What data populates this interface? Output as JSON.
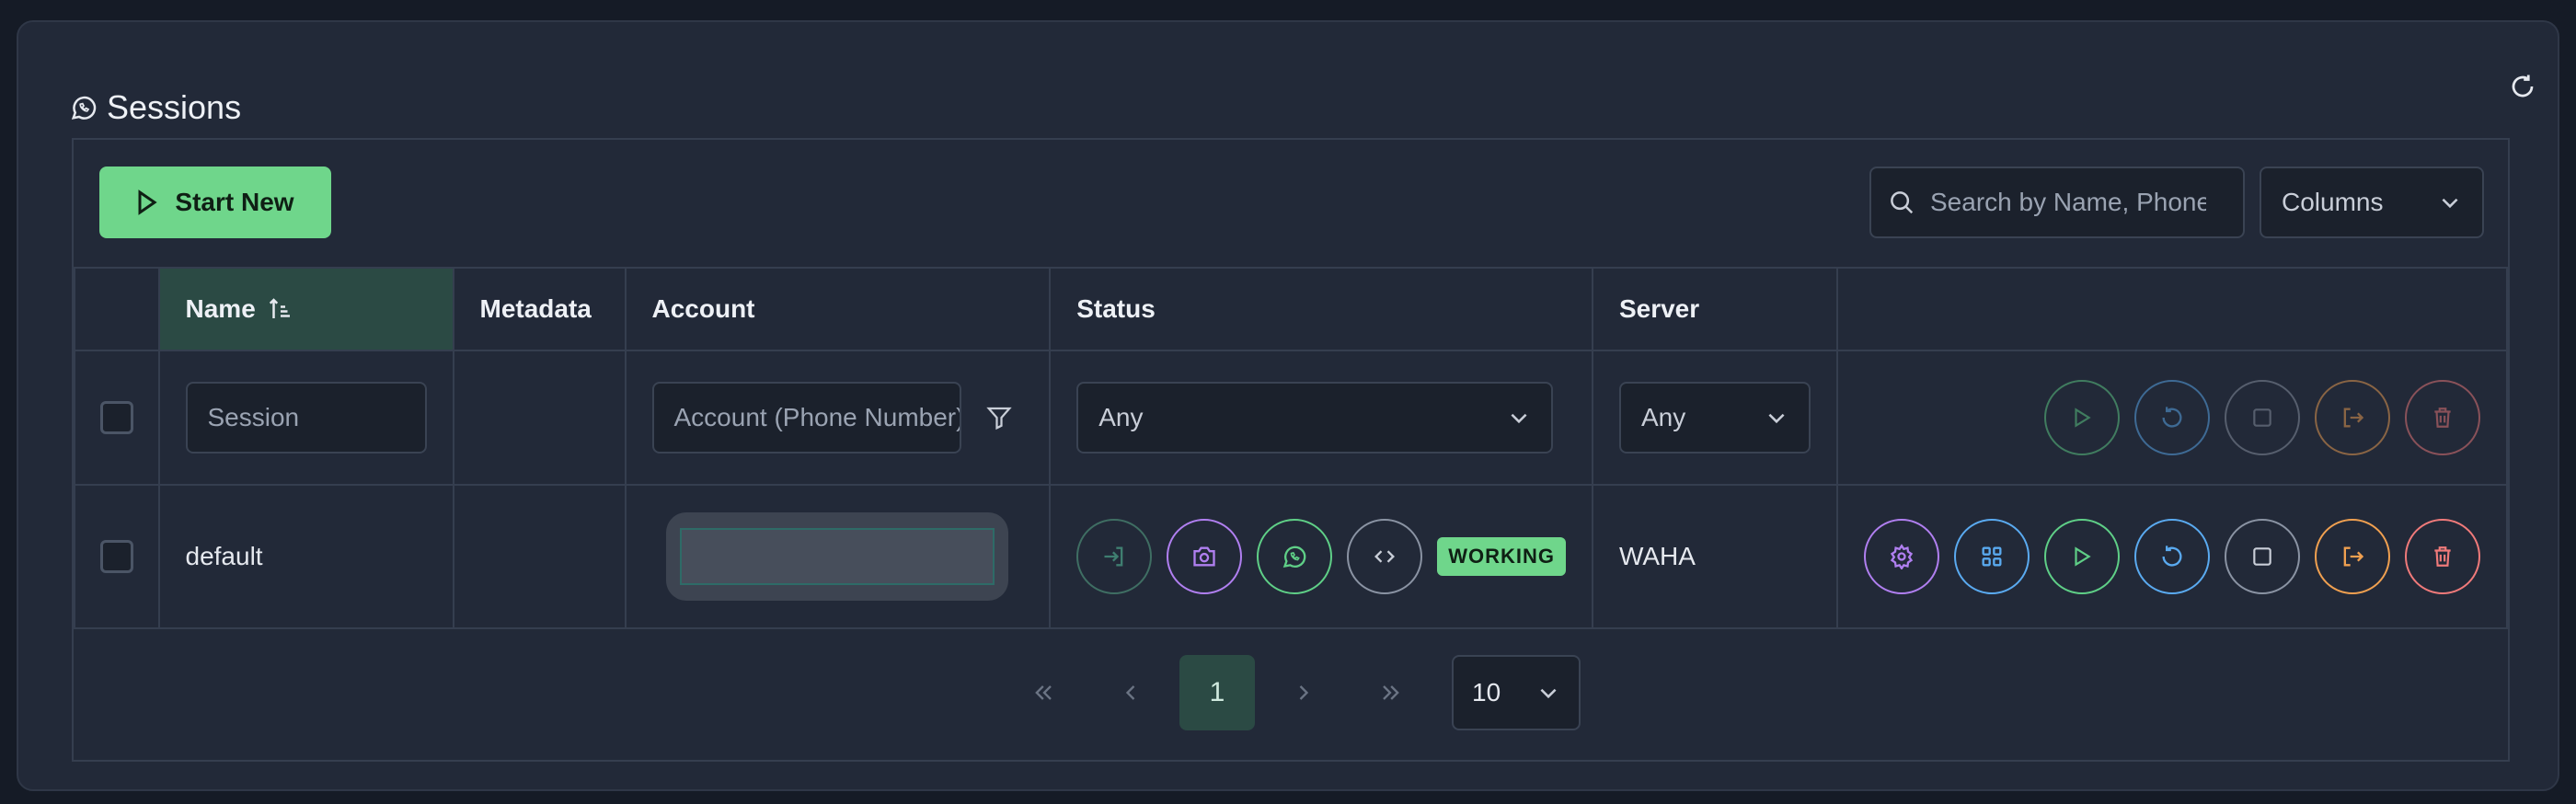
{
  "header": {
    "title": "Sessions"
  },
  "toolbar": {
    "start_label": "Start New",
    "search_placeholder": "Search by Name, Phone",
    "columns_label": "Columns"
  },
  "table": {
    "headers": [
      "Name",
      "Metadata",
      "Account",
      "Status",
      "Server"
    ],
    "filters": {
      "session_placeholder": "Session",
      "account_placeholder": "Account (Phone Number)",
      "status_value": "Any",
      "server_value": "Any"
    },
    "rows": [
      {
        "name": "default",
        "status": "WORKING",
        "server": "WAHA"
      }
    ]
  },
  "pagination": {
    "current_page": "1",
    "page_size": "10"
  },
  "colors": {
    "accent_green": "#6fd68b",
    "purple": "#b07ff0",
    "blue": "#5aaaf0",
    "green": "#5fcf87",
    "orange": "#f0a050",
    "red": "#f07a7a",
    "gray": "#8a93a3"
  }
}
